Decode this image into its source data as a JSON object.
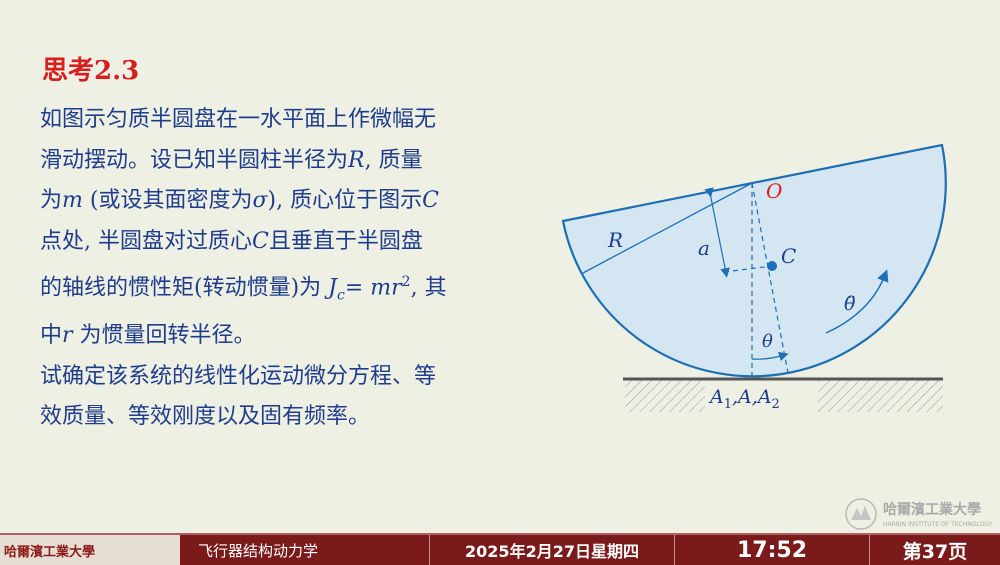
{
  "title": "思考2.3",
  "problem": {
    "l1": "如图示匀质半圆盘在一水平面上作微幅无",
    "l2a": "滑动摆动。设已知半圆柱半径为",
    "l2R": "R",
    "l2b": ", 质量",
    "l3a": "为",
    "l3m": "m",
    "l3b": " (或设其面密度为",
    "l3s": "σ",
    "l3c": "), 质心位于图示",
    "l3C": "C",
    "l4a": "点处, 半圆盘对过质心",
    "l4C": "C",
    "l4b": "且垂直于半圆盘",
    "l5a": "的轴线的惯性矩(转动惯量)为 ",
    "l5J": "J",
    "l5sub": "c",
    "l5eq": "= ",
    "l5mr": "mr",
    "l5sup": "2",
    "l5b": ", 其",
    "l6a": "中",
    "l6r": "r",
    "l6b": " 为惯量回转半径。",
    "l7": "试确定该系统的线性化运动微分方程、等",
    "l8": "效质量、等效刚度以及固有频率。"
  },
  "diagram": {
    "label_O": "O",
    "label_R": "R",
    "label_a": "a",
    "label_C": "C",
    "label_theta": "θ",
    "label_thetaddot": "θ̈",
    "label_A": "A",
    "label_A_sub1": "1",
    "label_A_mid": ",A,A",
    "label_A_sub2": "2",
    "colors": {
      "disc_fill": "#d3e6f2",
      "disc_stroke": "#1c6fb5",
      "label_O": "#d81e1e",
      "center": "#1c6fb5"
    }
  },
  "watermark": {
    "name": "哈爾濱工業大學",
    "sub": "HARBIN INSTITUTE OF TECHNOLOGY"
  },
  "footer": {
    "logo": "哈爾濱工業大學",
    "course": "飞行器结构动力学",
    "date": "2025年2月27日星期四",
    "time": "17:52",
    "page": "第37页"
  }
}
